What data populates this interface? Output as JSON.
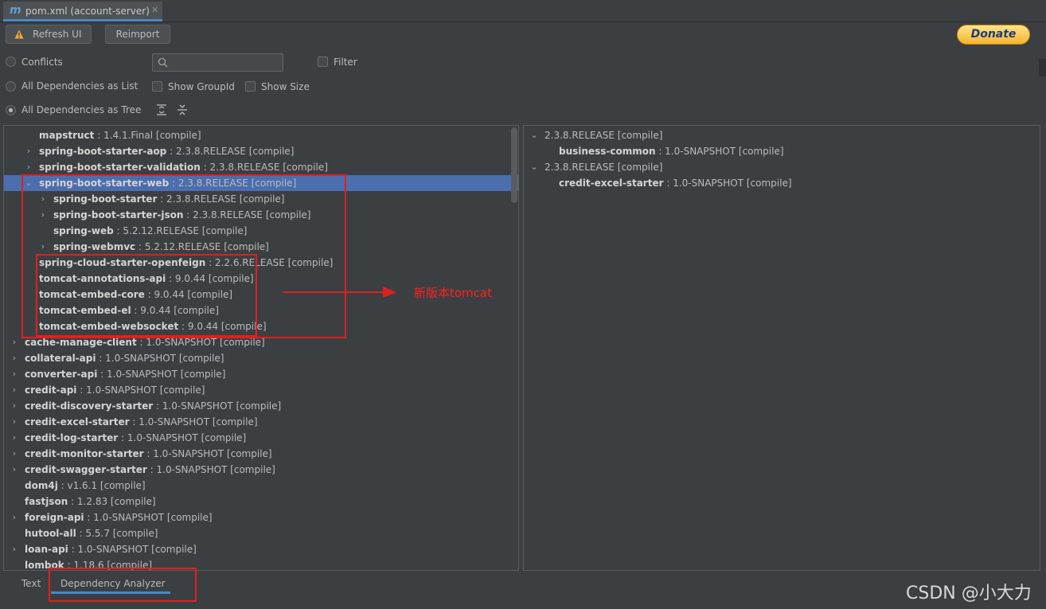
{
  "tab": {
    "icon": "m",
    "title": "pom.xml (account-server)",
    "close": "✕"
  },
  "toolbar": {
    "refresh_label": "Refresh UI",
    "reimport_label": "Reimport",
    "donate_label": "Donate"
  },
  "options": {
    "conflicts": "Conflicts",
    "filter": "Filter",
    "all_list": "All Dependencies as List",
    "show_groupid": "Show GroupId",
    "show_size": "Show Size",
    "all_tree": "All Dependencies as Tree",
    "selected_mode": "All Dependencies as Tree"
  },
  "left_tree": [
    {
      "name": "mapstruct",
      "ver": " : 1.4.1.Final [compile]",
      "depth": 1,
      "chevron": ""
    },
    {
      "name": "spring-boot-starter-aop",
      "ver": " : 2.3.8.RELEASE [compile]",
      "depth": 1,
      "chevron": "›"
    },
    {
      "name": "spring-boot-starter-validation",
      "ver": " : 2.3.8.RELEASE [compile]",
      "depth": 1,
      "chevron": "›"
    },
    {
      "name": "spring-boot-starter-web",
      "ver": " : 2.3.8.RELEASE [compile]",
      "depth": 1,
      "chevron": "⌄",
      "selected": true
    },
    {
      "name": "spring-boot-starter",
      "ver": " : 2.3.8.RELEASE [compile]",
      "depth": 2,
      "chevron": "›"
    },
    {
      "name": "spring-boot-starter-json",
      "ver": " : 2.3.8.RELEASE [compile]",
      "depth": 2,
      "chevron": "›"
    },
    {
      "name": "spring-web",
      "ver": " : 5.2.12.RELEASE [compile]",
      "depth": 2,
      "chevron": ""
    },
    {
      "name": "spring-webmvc",
      "ver": " : 5.2.12.RELEASE [compile]",
      "depth": 2,
      "chevron": "›"
    },
    {
      "name": "spring-cloud-starter-openfeign",
      "ver": " : 2.2.6.RELEASE [compile]",
      "depth": 1,
      "chevron": ""
    },
    {
      "name": "tomcat-annotations-api",
      "ver": " : 9.0.44 [compile]",
      "depth": 1,
      "chevron": ""
    },
    {
      "name": "tomcat-embed-core",
      "ver": " : 9.0.44 [compile]",
      "depth": 1,
      "chevron": ""
    },
    {
      "name": "tomcat-embed-el",
      "ver": " : 9.0.44 [compile]",
      "depth": 1,
      "chevron": ""
    },
    {
      "name": "tomcat-embed-websocket",
      "ver": " : 9.0.44 [compile]",
      "depth": 1,
      "chevron": ""
    },
    {
      "name": "cache-manage-client",
      "ver": " : 1.0-SNAPSHOT [compile]",
      "depth": 0,
      "chevron": "›"
    },
    {
      "name": "collateral-api",
      "ver": " : 1.0-SNAPSHOT [compile]",
      "depth": 0,
      "chevron": "›"
    },
    {
      "name": "converter-api",
      "ver": " : 1.0-SNAPSHOT [compile]",
      "depth": 0,
      "chevron": "›"
    },
    {
      "name": "credit-api",
      "ver": " : 1.0-SNAPSHOT [compile]",
      "depth": 0,
      "chevron": "›"
    },
    {
      "name": "credit-discovery-starter",
      "ver": " : 1.0-SNAPSHOT [compile]",
      "depth": 0,
      "chevron": "›"
    },
    {
      "name": "credit-excel-starter",
      "ver": " : 1.0-SNAPSHOT [compile]",
      "depth": 0,
      "chevron": "›"
    },
    {
      "name": "credit-log-starter",
      "ver": " : 1.0-SNAPSHOT [compile]",
      "depth": 0,
      "chevron": "›"
    },
    {
      "name": "credit-monitor-starter",
      "ver": " : 1.0-SNAPSHOT [compile]",
      "depth": 0,
      "chevron": "›"
    },
    {
      "name": "credit-swagger-starter",
      "ver": " : 1.0-SNAPSHOT [compile]",
      "depth": 0,
      "chevron": "›"
    },
    {
      "name": "dom4j",
      "ver": " : v1.6.1 [compile]",
      "depth": 0,
      "chevron": ""
    },
    {
      "name": "fastjson",
      "ver": " : 1.2.83 [compile]",
      "depth": 0,
      "chevron": ""
    },
    {
      "name": "foreign-api",
      "ver": " : 1.0-SNAPSHOT [compile]",
      "depth": 0,
      "chevron": "›"
    },
    {
      "name": "hutool-all",
      "ver": " : 5.5.7 [compile]",
      "depth": 0,
      "chevron": ""
    },
    {
      "name": "loan-api",
      "ver": " : 1.0-SNAPSHOT [compile]",
      "depth": 0,
      "chevron": "›"
    },
    {
      "name": "lombok",
      "ver": " : 1.18.6 [compile]",
      "depth": 0,
      "chevron": ""
    }
  ],
  "right_tree": [
    {
      "name": "",
      "ver": "2.3.8.RELEASE [compile]",
      "depth": 0,
      "chevron": "⌄"
    },
    {
      "name": "business-common",
      "ver": " : 1.0-SNAPSHOT [compile]",
      "depth": 1,
      "chevron": ""
    },
    {
      "name": "",
      "ver": "2.3.8.RELEASE [compile]",
      "depth": 0,
      "chevron": "⌄"
    },
    {
      "name": "credit-excel-starter",
      "ver": " : 1.0-SNAPSHOT [compile]",
      "depth": 1,
      "chevron": ""
    }
  ],
  "annotation": {
    "text": "新版本tomcat",
    "color": "#ff2020"
  },
  "bottom_tabs": {
    "text": "Text",
    "analyzer": "Dependency Analyzer"
  },
  "watermark": "CSDN @小大力",
  "colors": {
    "selection": "#4b6eaf",
    "annotation_red": "#e02020",
    "accent_blue": "#4a88c7"
  }
}
